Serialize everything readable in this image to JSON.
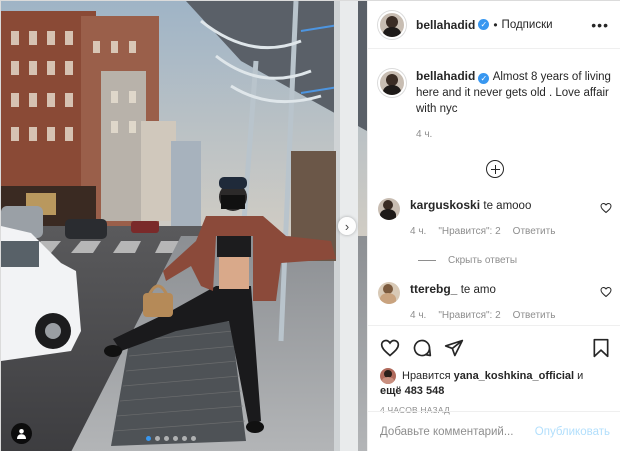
{
  "post": {
    "username": "bellahadid",
    "verified": true,
    "follow_label": "Подписки",
    "more_label": "•••",
    "caption": "Almost 8 years of living here and it never gets old . Love affair with nyc",
    "caption_time": "4 ч.",
    "load_more_label": "+"
  },
  "comments": [
    {
      "username": "karguskoski",
      "text": "te amooo",
      "time": "4 ч.",
      "likes": "\"Нравится\": 2",
      "reply_label": "Ответить",
      "hide_replies_label": "Скрыть ответы"
    },
    {
      "username": "tterebg_",
      "text": "te amo",
      "time": "4 ч.",
      "likes": "\"Нравится\": 2",
      "reply_label": "Ответить"
    }
  ],
  "likes_section": {
    "prefix": "Нравится",
    "liker": "yana_koshkina_official",
    "joiner": "и",
    "others": "ещё 483 548",
    "time_ago": "4 ЧАСОВ НАЗАД"
  },
  "add_comment": {
    "placeholder": "Добавьте комментарий...",
    "publish_label": "Опубликовать"
  },
  "carousel": {
    "dots_count": 6,
    "active_index": 0
  },
  "colors": {
    "accent": "#3897f0",
    "publish_disabled": "#b2dffc",
    "muted": "#8e8e8e",
    "text": "#262626"
  },
  "icons": [
    "heart-icon",
    "comment-icon",
    "share-icon",
    "bookmark-icon",
    "tag-user-icon",
    "chevron-right-icon",
    "more-options-icon",
    "verified-badge-icon",
    "add-circle-icon"
  ]
}
